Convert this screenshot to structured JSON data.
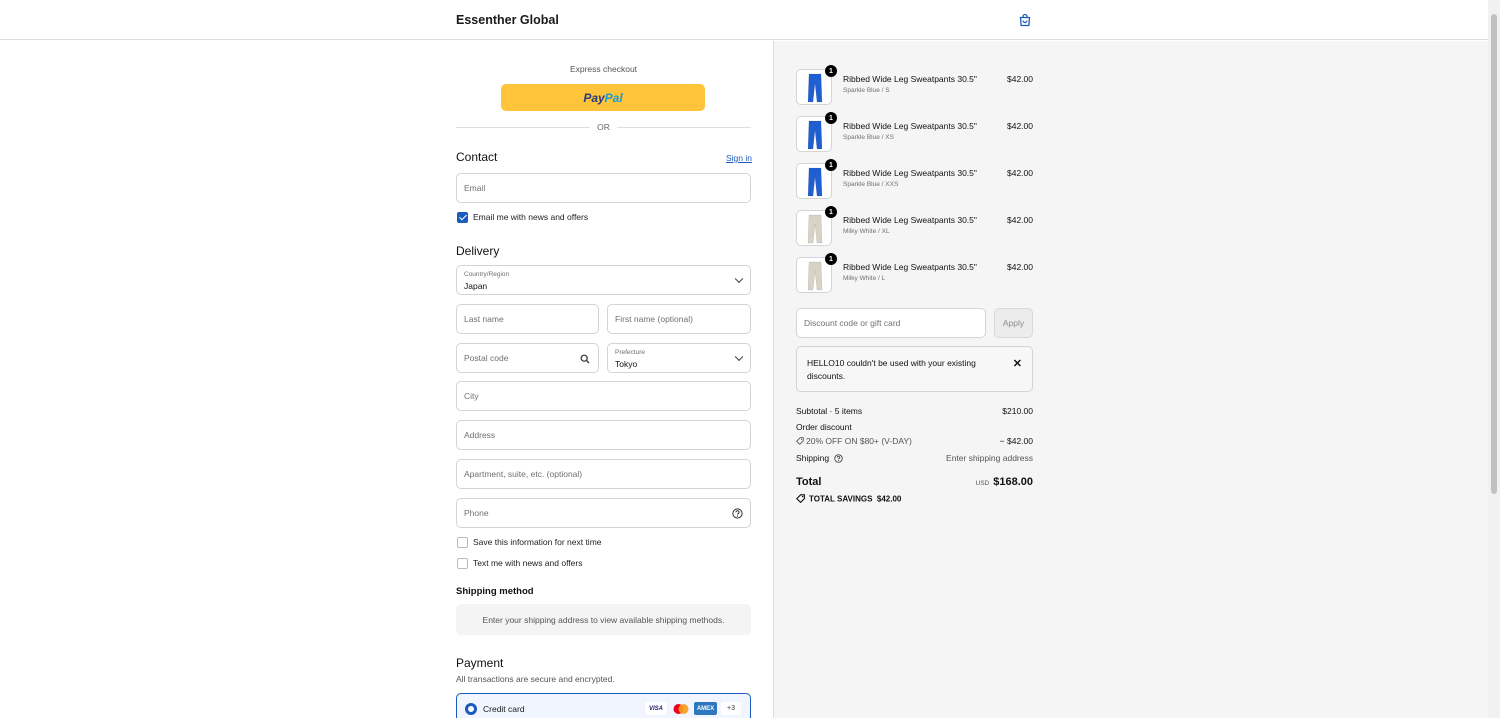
{
  "header": {
    "brand": "Essenther Global",
    "cart_icon": "shopping-bag-icon"
  },
  "express": {
    "label": "Express checkout",
    "paypal_pay": "Pay",
    "paypal_pal": "Pal",
    "or": "OR"
  },
  "contact": {
    "title": "Contact",
    "sign_in": "Sign in",
    "email_placeholder": "Email",
    "newsletter_label": "Email me with news and offers",
    "newsletter_checked": true
  },
  "delivery": {
    "title": "Delivery",
    "country_label": "Country/Region",
    "country_value": "Japan",
    "last_name": "Last name",
    "first_name": "First name (optional)",
    "postal_code": "Postal code",
    "prefecture_label": "Prefecture",
    "prefecture_value": "Tokyo",
    "city": "City",
    "address": "Address",
    "apartment": "Apartment, suite, etc. (optional)",
    "phone": "Phone",
    "save_info": "Save this information for next time",
    "text_me": "Text me with news and offers"
  },
  "shipping": {
    "title": "Shipping method",
    "message": "Enter your shipping address to view available shipping methods."
  },
  "payment": {
    "title": "Payment",
    "subtitle": "All transactions are secure and encrypted.",
    "method": "Credit card",
    "cards": [
      "VISA",
      "",
      "AMEX"
    ],
    "more": "+3"
  },
  "cart": {
    "items": [
      {
        "title": "Ribbed Wide Leg Sweatpants 30.5\"",
        "variant": "Sparkle Blue / S",
        "price": "$42.00",
        "qty": "1",
        "color": "#1f5fd1"
      },
      {
        "title": "Ribbed Wide Leg Sweatpants 30.5\"",
        "variant": "Sparkle Blue / XS",
        "price": "$42.00",
        "qty": "1",
        "color": "#1f5fd1"
      },
      {
        "title": "Ribbed Wide Leg Sweatpants 30.5\"",
        "variant": "Sparkle Blue / XXS",
        "price": "$42.00",
        "qty": "1",
        "color": "#1f5fd1"
      },
      {
        "title": "Ribbed Wide Leg Sweatpants 30.5\"",
        "variant": "Milky White / XL",
        "price": "$42.00",
        "qty": "1",
        "color": "#d9d2c6"
      },
      {
        "title": "Ribbed Wide Leg Sweatpants 30.5\"",
        "variant": "Milky White / L",
        "price": "$42.00",
        "qty": "1",
        "color": "#d9d2c6"
      }
    ],
    "discount_placeholder": "Discount code or gift card",
    "apply": "Apply",
    "error": "HELLO10 couldn't be used with your existing discounts.",
    "subtotal_label": "Subtotal · 5 items",
    "subtotal_value": "$210.00",
    "order_discount_label": "Order discount",
    "discount_code": "20% OFF ON $80+ (V-DAY)",
    "discount_value": "− $42.00",
    "shipping_label": "Shipping",
    "shipping_value": "Enter shipping address",
    "total_label": "Total",
    "currency": "USD",
    "total_value": "$168.00",
    "savings_label": "TOTAL SAVINGS",
    "savings_value": "$42.00"
  },
  "colors": {
    "accent": "#1a5bbd",
    "paypal": "#ffc439"
  }
}
